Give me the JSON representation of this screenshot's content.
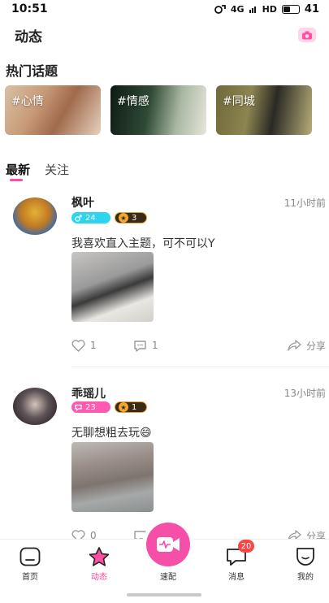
{
  "status_bar": {
    "time": "10:51",
    "network": "4G",
    "hd": "HD",
    "battery": "41"
  },
  "header": {
    "title": "动态",
    "camera_icon": "camera-icon"
  },
  "hot_topics": {
    "title": "热门话题",
    "items": [
      {
        "label": "#心情"
      },
      {
        "label": "#情感"
      },
      {
        "label": "#同城"
      }
    ]
  },
  "tabs": [
    {
      "label": "最新",
      "active": true
    },
    {
      "label": "关注",
      "active": false
    }
  ],
  "posts": [
    {
      "username": "枫叶",
      "time": "11小时前",
      "gender": "male",
      "gender_value": "24",
      "level": "3",
      "content": "我喜欢直入主题，可不可以Y",
      "likes": "1",
      "comments": "1",
      "share_label": "分享"
    },
    {
      "username": "乖瑶儿",
      "time": "13小时前",
      "gender": "female",
      "gender_value": "23",
      "level": "1",
      "content": "无聊想粗去玩😄",
      "likes": "0",
      "comments": "",
      "share_label": "分享"
    }
  ],
  "bottom_nav": [
    {
      "label": "首页",
      "icon": "home-icon",
      "active": false
    },
    {
      "label": "动态",
      "icon": "moment-star-icon",
      "active": true
    },
    {
      "label": "速配",
      "icon": "video-match-icon",
      "active": false
    },
    {
      "label": "消息",
      "icon": "message-icon",
      "badge": "20",
      "active": false
    },
    {
      "label": "我的",
      "icon": "profile-icon",
      "active": false
    }
  ],
  "colors": {
    "accent": "#ff4fa5",
    "male": "#2bd5f0",
    "female": "#ff5ab2",
    "badge_red": "#ff4444"
  }
}
